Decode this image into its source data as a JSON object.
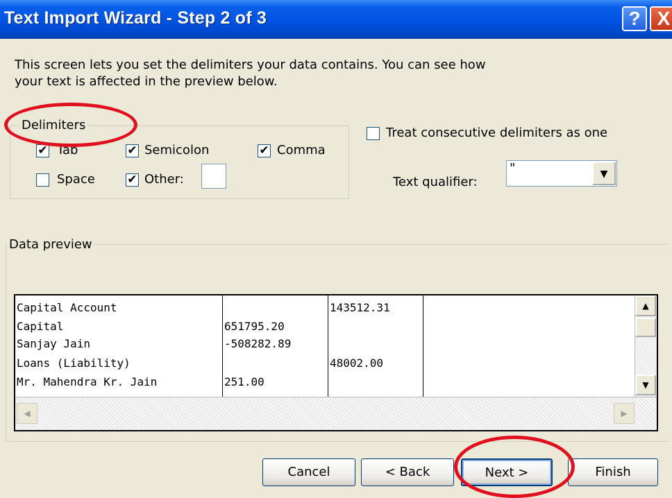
{
  "window": {
    "title": "Text Import Wizard - Step 2 of 3",
    "help_label": "?",
    "close_label": "X"
  },
  "description": "This screen lets you set the delimiters your data contains.  You can see how your text is affected in the preview below.",
  "delimiters": {
    "legend": "Delimiters",
    "items": [
      {
        "label": "Tab",
        "checked": true
      },
      {
        "label": "Semicolon",
        "checked": true
      },
      {
        "label": "Comma",
        "checked": true
      },
      {
        "label": "Space",
        "checked": false
      },
      {
        "label": "Other:",
        "checked": true
      }
    ],
    "other_value": ""
  },
  "consecutive": {
    "label": "Treat consecutive delimiters as one",
    "checked": false
  },
  "qualifier": {
    "label": "Text qualifier:",
    "value": "\""
  },
  "preview": {
    "legend": "Data preview",
    "rows": [
      [
        "Capital Account",
        "",
        "143512.31"
      ],
      [
        "Capital",
        "651795.20",
        ""
      ],
      [
        "Sanjay Jain",
        "-508282.89",
        ""
      ],
      [
        "Loans (Liability)",
        "",
        "48002.00"
      ],
      [
        "Mr. Mahendra Kr. Jain",
        "251.00",
        ""
      ]
    ]
  },
  "buttons": {
    "cancel": "Cancel",
    "back": "< Back",
    "next": "Next >",
    "finish": "Finish"
  },
  "colors": {
    "annotation": "#E0101F",
    "titlebar": "#0054E3"
  }
}
